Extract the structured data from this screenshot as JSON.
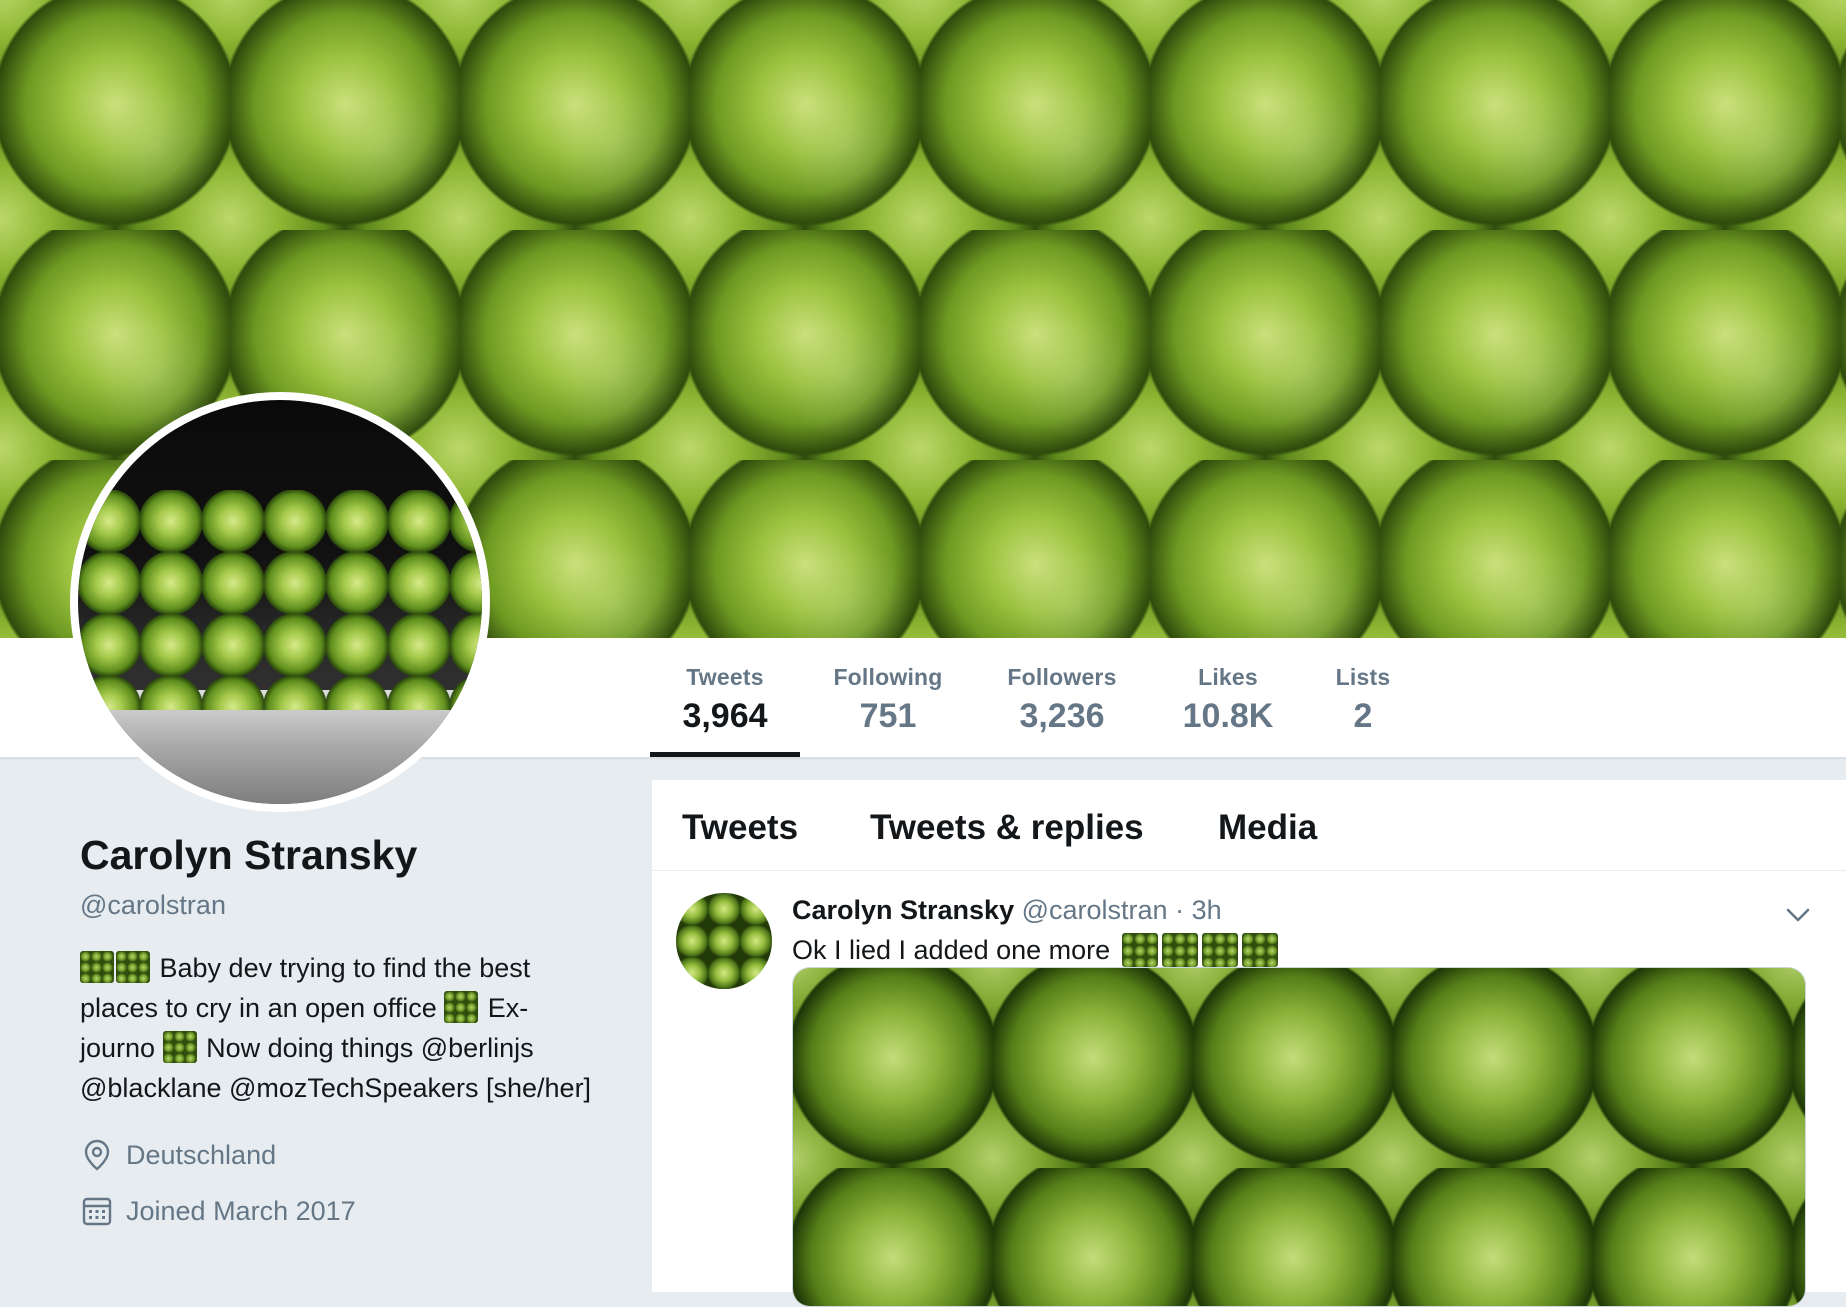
{
  "profile": {
    "name": "Carolyn Stransky",
    "handle": "@carolstran",
    "bio_line1": "Baby dev trying to find the best",
    "bio_line2": "places to cry in an open office",
    "bio_line2b": "Ex-",
    "bio_line3": "journo",
    "bio_line3b": "Now doing things @berlinjs",
    "bio_line4": "@blacklane @mozTechSpeakers [she/her]",
    "location": "Deutschland",
    "joined": "Joined March 2017",
    "location_icon": "location-pin-icon",
    "joined_icon": "calendar-icon"
  },
  "stats": [
    {
      "label": "Tweets",
      "value": "3,964",
      "active": true
    },
    {
      "label": "Following",
      "value": "751",
      "active": false
    },
    {
      "label": "Followers",
      "value": "3,236",
      "active": false
    },
    {
      "label": "Likes",
      "value": "10.8K",
      "active": false
    },
    {
      "label": "Lists",
      "value": "2",
      "active": false
    }
  ],
  "tabs": [
    "Tweets",
    "Tweets & replies",
    "Media"
  ],
  "tweet": {
    "name": "Carolyn Stransky",
    "handle": "@carolstran",
    "time": "· 3h",
    "text": "Ok I lied I added one more",
    "menu_icon": "chevron-down-icon"
  },
  "colors": {
    "secondary_text": "#657786",
    "primary_text": "#14171a",
    "page_bg": "#e6ecf0"
  }
}
